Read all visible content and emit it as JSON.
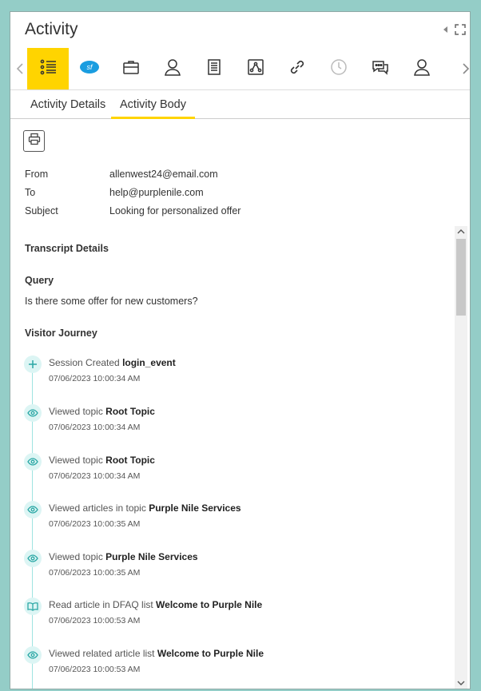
{
  "panel": {
    "title": "Activity"
  },
  "toolbar": {
    "buttons": [
      {
        "icon": "list-icon"
      },
      {
        "icon": "salesforce-icon",
        "label": "sf"
      },
      {
        "icon": "briefcase-icon"
      },
      {
        "icon": "contact-icon"
      },
      {
        "icon": "document-icon"
      },
      {
        "icon": "network-icon"
      },
      {
        "icon": "link-icon"
      },
      {
        "icon": "history-icon"
      },
      {
        "icon": "chat-icon"
      },
      {
        "icon": "user-icon"
      }
    ]
  },
  "tabs": [
    {
      "label": "Activity Details"
    },
    {
      "label": "Activity Body"
    }
  ],
  "email": {
    "from_label": "From",
    "from": "allenwest24@email.com",
    "to_label": "To",
    "to": "help@purplenile.com",
    "subject_label": "Subject",
    "subject": "Looking for personalized offer"
  },
  "transcript": {
    "heading": "Transcript Details",
    "query_heading": "Query",
    "query": "Is there some offer for new customers?",
    "journey_heading": "Visitor Journey",
    "events": [
      {
        "icon": "plus-icon",
        "text": "Session Created ",
        "bold": "login_event",
        "time": "07/06/2023 10:00:34 AM"
      },
      {
        "icon": "eye-icon",
        "text": "Viewed topic ",
        "bold": "Root Topic",
        "time": "07/06/2023 10:00:34 AM"
      },
      {
        "icon": "eye-icon",
        "text": "Viewed topic ",
        "bold": "Root Topic",
        "time": "07/06/2023 10:00:34 AM"
      },
      {
        "icon": "eye-icon",
        "text": "Viewed articles in topic ",
        "bold": "Purple Nile Services",
        "time": "07/06/2023 10:00:35 AM"
      },
      {
        "icon": "eye-icon",
        "text": "Viewed topic ",
        "bold": "Purple Nile Services",
        "time": "07/06/2023 10:00:35 AM"
      },
      {
        "icon": "book-icon",
        "text": "Read article in DFAQ list ",
        "bold": "Welcome to Purple Nile",
        "time": "07/06/2023 10:00:53 AM"
      },
      {
        "icon": "eye-icon",
        "text": "Viewed related article list ",
        "bold": "Welcome to Purple Nile",
        "time": "07/06/2023 10:00:53 AM"
      }
    ]
  },
  "colors": {
    "accent": "#ffd400",
    "timeline": "#9fe3e1",
    "background": "#94cdc7"
  }
}
